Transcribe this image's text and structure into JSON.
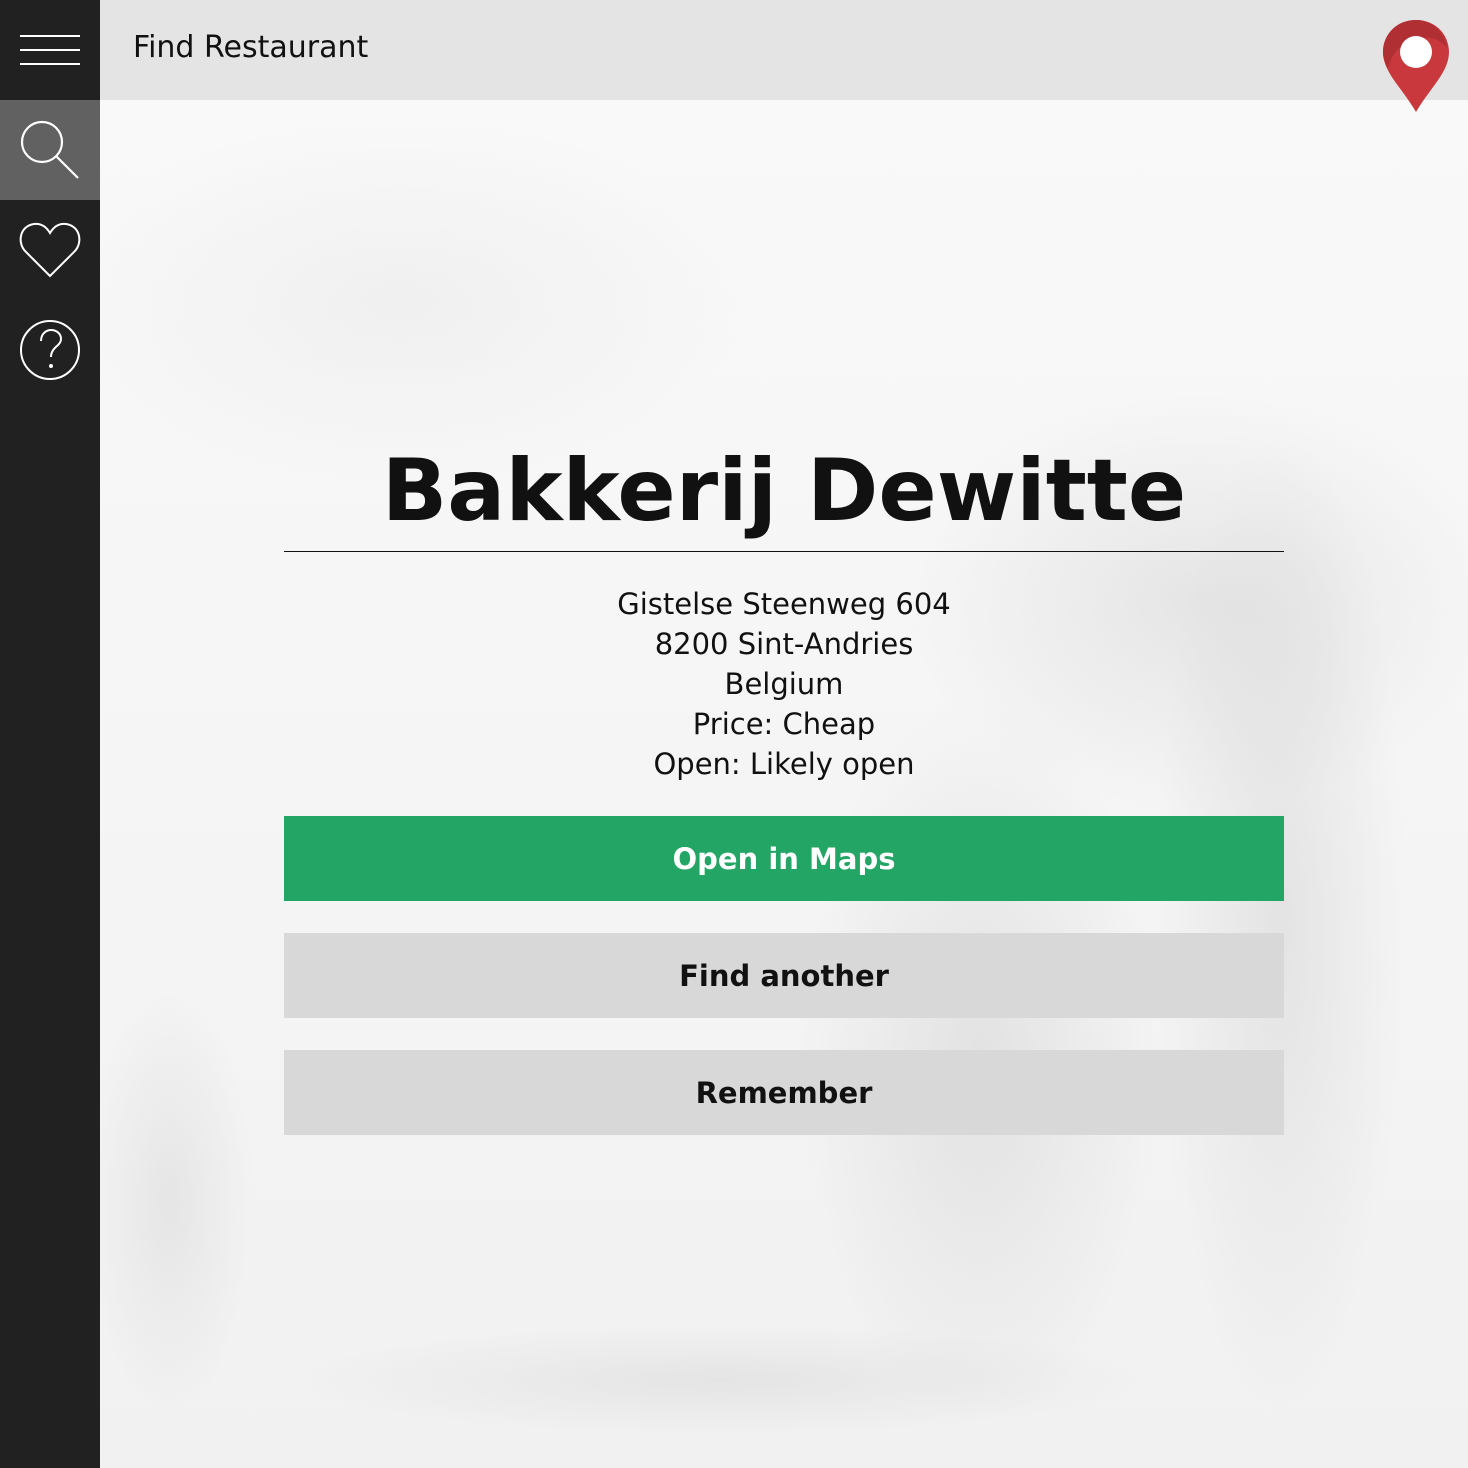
{
  "header": {
    "title": "Find Restaurant"
  },
  "sidebar": {
    "items": [
      {
        "icon": "menu-icon",
        "active": false
      },
      {
        "icon": "search-icon",
        "active": true
      },
      {
        "icon": "heart-icon",
        "active": false
      },
      {
        "icon": "help-icon",
        "active": false
      }
    ]
  },
  "restaurant": {
    "name": "Bakkerij Dewitte",
    "address_line1": "Gistelse Steenweg 604",
    "address_line2": "8200 Sint-Andries",
    "country": "Belgium",
    "price": "Price: Cheap",
    "open": "Open: Likely open"
  },
  "actions": {
    "open_maps": "Open in Maps",
    "find_another": "Find another",
    "remember": "Remember"
  },
  "colors": {
    "sidebar_bg": "#212121",
    "sidebar_active": "#616161",
    "topbar_bg": "#e4e4e4",
    "primary_button": "#22a565",
    "secondary_button": "#d8d8d8",
    "pin": "#c8383c"
  }
}
